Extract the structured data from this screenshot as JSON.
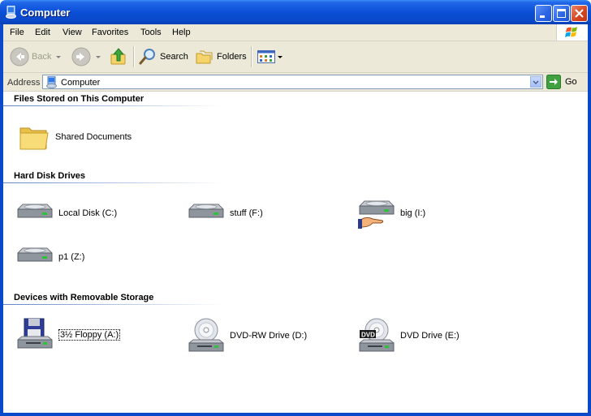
{
  "window": {
    "title": "Computer"
  },
  "menu": [
    "File",
    "Edit",
    "View",
    "Favorites",
    "Tools",
    "Help"
  ],
  "toolbar": {
    "back": "Back",
    "search": "Search",
    "folders": "Folders"
  },
  "address": {
    "label": "Address",
    "value": "Computer",
    "go": "Go"
  },
  "groups": {
    "files": {
      "heading": "Files Stored on This Computer",
      "items": [
        "Shared Documents"
      ]
    },
    "hdd": {
      "heading": "Hard Disk Drives",
      "items": [
        "Local Disk (C:)",
        "stuff (F:)",
        "big (I:)",
        "p1 (Z:)"
      ]
    },
    "removable": {
      "heading": "Devices with Removable Storage",
      "items": [
        "3½ Floppy (A:)",
        "DVD-RW Drive (D:)",
        "DVD Drive (E:)"
      ]
    }
  },
  "colors": {
    "titlebar": "#0a4fd6",
    "face": "#ece9d8",
    "accent": "#5f84c7"
  },
  "icons": {
    "app": "computer-icon",
    "back": "back-arrow-icon",
    "forward": "forward-arrow-icon",
    "up": "up-folder-icon",
    "search": "magnifier-icon",
    "folders": "folders-icon",
    "views": "views-icon",
    "go": "go-arrow-icon",
    "shared": "folder-icon",
    "disk": "hard-disk-icon",
    "shared-disk": "shared-hard-disk-icon",
    "floppy": "floppy-drive-icon",
    "cd": "cd-drive-icon",
    "dvd": "dvd-drive-icon"
  },
  "dvd_badge": "DVD"
}
